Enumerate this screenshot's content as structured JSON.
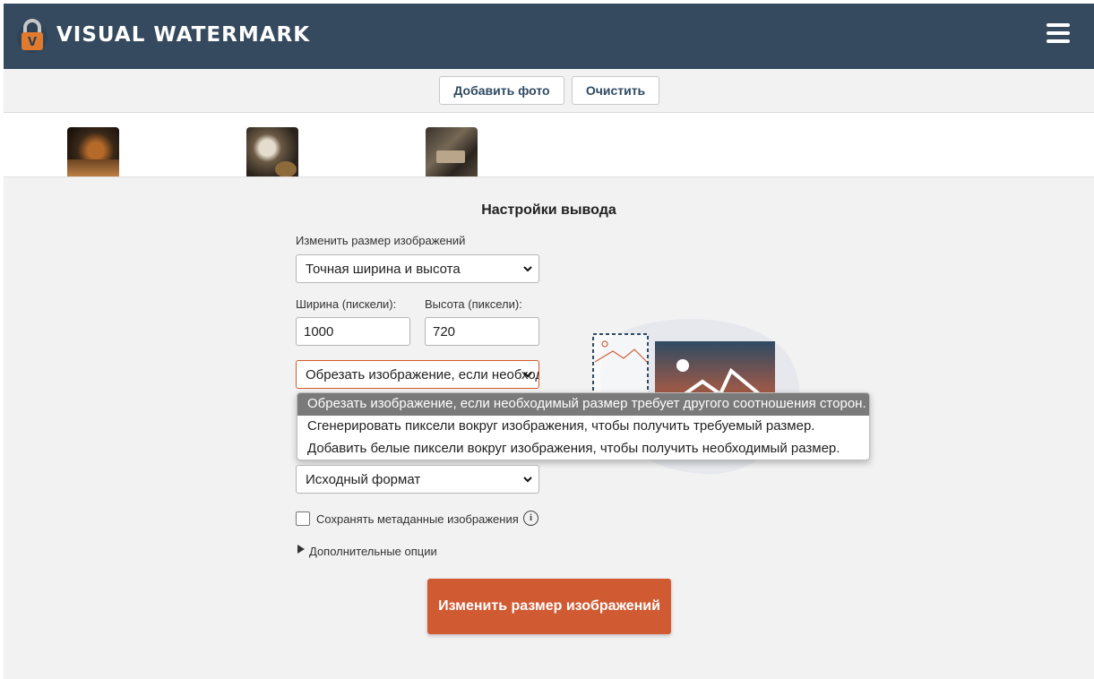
{
  "header": {
    "logo_letter": "V",
    "title": "VISUAL WATERMARK",
    "menu_icon": "hamburger-menu-icon",
    "background_color": "#354a5f"
  },
  "toolbar": {
    "add_photo_label": "Добавить фото",
    "clear_label": "Очистить"
  },
  "thumbnails": [
    {
      "name": "photo-tea-glass"
    },
    {
      "name": "photo-coffee-cup"
    },
    {
      "name": "photo-cafe-table"
    }
  ],
  "settings": {
    "title": "Настройки вывода",
    "resize_label": "Изменить размер изображений",
    "resize_mode_value": "Точная ширина и высота",
    "width_label": "Ширина (пискели):",
    "height_label": "Высота (пиксели):",
    "width_value": "1000",
    "height_value": "720",
    "fit_mode_value": "Обрезать изображение, если необходимый размер требует другого соотношения сторон.",
    "fit_mode_options": [
      "Обрезать изображение, если необходимый размер требует другого соотношения сторон.",
      "Сгенерировать пиксели вокруг изображения, чтобы получить требуемый размер.",
      "Добавить белые пиксели вокруг изображения, чтобы получить необходимый размер."
    ],
    "format_value": "Исходный формат",
    "keep_metadata_label": "Сохранять метаданные изображения",
    "keep_metadata_checked": false,
    "advanced_label": "Дополнительные опции",
    "submit_label": "Изменить размер изображений",
    "accent_color": "#d05a32"
  }
}
